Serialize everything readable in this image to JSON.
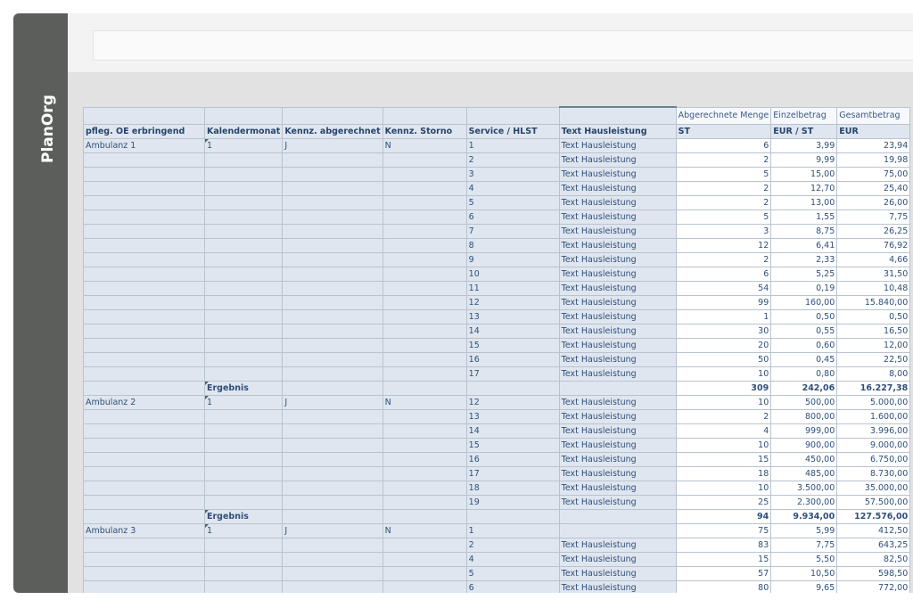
{
  "logo": "PlanOrg",
  "table": {
    "headers": [
      "pfleg. OE erbringend",
      "Kalendermonat",
      "Kennz. abgerechnet",
      "Kennz. Storno",
      "Service / HLST",
      "Text Hausleistung"
    ],
    "measures": [
      "Abgerechnete Menge",
      "Einzelbetrag",
      "Gesamtbetrag"
    ],
    "units": [
      "ST",
      "EUR / ST",
      "EUR"
    ],
    "result_label": "Ergebnis",
    "groups": [
      {
        "oe": "Ambulanz 1",
        "month": "1",
        "abg": "J",
        "storno": "N",
        "rows": [
          {
            "svc": "1",
            "txt": "Text Hausleistung",
            "menge": "6",
            "einzel": "3,99",
            "gesamt": "23,94"
          },
          {
            "svc": "2",
            "txt": "Text Hausleistung",
            "menge": "2",
            "einzel": "9,99",
            "gesamt": "19,98"
          },
          {
            "svc": "3",
            "txt": "Text Hausleistung",
            "menge": "5",
            "einzel": "15,00",
            "gesamt": "75,00"
          },
          {
            "svc": "4",
            "txt": "Text Hausleistung",
            "menge": "2",
            "einzel": "12,70",
            "gesamt": "25,40"
          },
          {
            "svc": "5",
            "txt": "Text Hausleistung",
            "menge": "2",
            "einzel": "13,00",
            "gesamt": "26,00"
          },
          {
            "svc": "6",
            "txt": "Text Hausleistung",
            "menge": "5",
            "einzel": "1,55",
            "gesamt": "7,75"
          },
          {
            "svc": "7",
            "txt": "Text Hausleistung",
            "menge": "3",
            "einzel": "8,75",
            "gesamt": "26,25"
          },
          {
            "svc": "8",
            "txt": "Text Hausleistung",
            "menge": "12",
            "einzel": "6,41",
            "gesamt": "76,92"
          },
          {
            "svc": "9",
            "txt": "Text Hausleistung",
            "menge": "2",
            "einzel": "2,33",
            "gesamt": "4,66"
          },
          {
            "svc": "10",
            "txt": "Text Hausleistung",
            "menge": "6",
            "einzel": "5,25",
            "gesamt": "31,50"
          },
          {
            "svc": "11",
            "txt": "Text Hausleistung",
            "menge": "54",
            "einzel": "0,19",
            "gesamt": "10,48"
          },
          {
            "svc": "12",
            "txt": "Text Hausleistung",
            "menge": "99",
            "einzel": "160,00",
            "gesamt": "15.840,00"
          },
          {
            "svc": "13",
            "txt": "Text Hausleistung",
            "menge": "1",
            "einzel": "0,50",
            "gesamt": "0,50"
          },
          {
            "svc": "14",
            "txt": "Text Hausleistung",
            "menge": "30",
            "einzel": "0,55",
            "gesamt": "16,50"
          },
          {
            "svc": "15",
            "txt": "Text Hausleistung",
            "menge": "20",
            "einzel": "0,60",
            "gesamt": "12,00"
          },
          {
            "svc": "16",
            "txt": "Text Hausleistung",
            "menge": "50",
            "einzel": "0,45",
            "gesamt": "22,50"
          },
          {
            "svc": "17",
            "txt": "Text Hausleistung",
            "menge": "10",
            "einzel": "0,80",
            "gesamt": "8,00"
          }
        ],
        "total": {
          "menge": "309",
          "einzel": "242,06",
          "gesamt": "16.227,38"
        }
      },
      {
        "oe": "Ambulanz 2",
        "month": "1",
        "abg": "J",
        "storno": "N",
        "rows": [
          {
            "svc": "12",
            "txt": "Text Hausleistung",
            "menge": "10",
            "einzel": "500,00",
            "gesamt": "5.000,00"
          },
          {
            "svc": "13",
            "txt": "Text Hausleistung",
            "menge": "2",
            "einzel": "800,00",
            "gesamt": "1.600,00"
          },
          {
            "svc": "14",
            "txt": "Text Hausleistung",
            "menge": "4",
            "einzel": "999,00",
            "gesamt": "3.996,00"
          },
          {
            "svc": "15",
            "txt": "Text Hausleistung",
            "menge": "10",
            "einzel": "900,00",
            "gesamt": "9.000,00"
          },
          {
            "svc": "16",
            "txt": "Text Hausleistung",
            "menge": "15",
            "einzel": "450,00",
            "gesamt": "6.750,00"
          },
          {
            "svc": "17",
            "txt": "Text Hausleistung",
            "menge": "18",
            "einzel": "485,00",
            "gesamt": "8.730,00"
          },
          {
            "svc": "18",
            "txt": "Text Hausleistung",
            "menge": "10",
            "einzel": "3.500,00",
            "gesamt": "35.000,00"
          },
          {
            "svc": "19",
            "txt": "Text Hausleistung",
            "menge": "25",
            "einzel": "2.300,00",
            "gesamt": "57.500,00"
          }
        ],
        "total": {
          "menge": "94",
          "einzel": "9.934,00",
          "gesamt": "127.576,00"
        }
      },
      {
        "oe": "Ambulanz 3",
        "month": "1",
        "abg": "J",
        "storno": "N",
        "rows": [
          {
            "svc": "1",
            "txt": "",
            "menge": "75",
            "einzel": "5,99",
            "gesamt": "412,50"
          },
          {
            "svc": "2",
            "txt": "Text Hausleistung",
            "menge": "83",
            "einzel": "7,75",
            "gesamt": "643,25"
          },
          {
            "svc": "4",
            "txt": "Text Hausleistung",
            "menge": "15",
            "einzel": "5,50",
            "gesamt": "82,50"
          },
          {
            "svc": "5",
            "txt": "Text Hausleistung",
            "menge": "57",
            "einzel": "10,50",
            "gesamt": "598,50"
          },
          {
            "svc": "6",
            "txt": "Text Hausleistung",
            "menge": "80",
            "einzel": "9,65",
            "gesamt": "772,00"
          }
        ],
        "total": null
      }
    ]
  }
}
